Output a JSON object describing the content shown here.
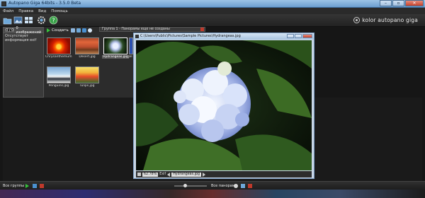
{
  "window": {
    "title": "Autopano Giga 64bits - 3.5.0 Beta",
    "minimize_label": "–",
    "maximize_label": "▫",
    "close_label": "✕"
  },
  "menu": [
    "Файл",
    "Правка",
    "Вид",
    "Помощь"
  ],
  "toolbar": {
    "icons": [
      "folder-open-icon",
      "images-icon",
      "grid-icon",
      "gear-icon",
      "help-icon"
    ],
    "brand": "kolor autopano giga"
  },
  "left_panel": {
    "count": "0 / 0",
    "header": "0 изображений",
    "info": "Отсутствует информация exif"
  },
  "images_panel": {
    "detect_label": "Создать",
    "thumbnails": [
      {
        "name": "Chrysanthemum.jpg",
        "selected": false
      },
      {
        "name": "Desert.jpg",
        "selected": false
      },
      {
        "name": "Hydrangeas.jpg",
        "selected": true
      },
      {
        "name": "Jel",
        "selected": false
      },
      {
        "name": "Penguins.jpg",
        "selected": false
      },
      {
        "name": "Tulips.jpg",
        "selected": false
      }
    ]
  },
  "group_bar": {
    "label": "Группа 1 - Панорамы еще не созданы"
  },
  "viewer": {
    "path": "C:\\Users\\Public\\Pictures\\Sample Pictures\\Hydrangeas.jpg",
    "zoom": "62.78%",
    "exif_label": "Exif",
    "file": "Hydrangeas.jpg"
  },
  "status": {
    "groups_label": "Все группы",
    "panoramas_label": "Все панорамы"
  },
  "colors": {
    "accent_green": "#35c23b",
    "title_blue": "#9cc3e6",
    "close_red": "#c7422b",
    "panel_bg": "#2c2c2c"
  }
}
